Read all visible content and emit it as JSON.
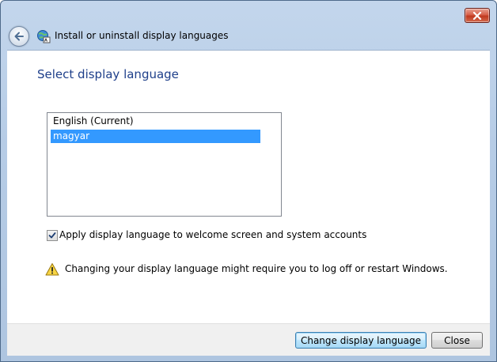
{
  "window": {
    "title": "Install or uninstall display languages"
  },
  "icons": {
    "close": "close-icon",
    "back": "back-arrow-icon",
    "app": "language-globe-icon",
    "warning": "warning-icon",
    "check": "check-icon"
  },
  "main": {
    "heading": "Select display language",
    "languages": [
      {
        "label": "English (Current)",
        "selected": false
      },
      {
        "label": "magyar",
        "selected": true
      }
    ],
    "apply_checkbox": {
      "label": "Apply display language to welcome screen and system accounts",
      "checked": true
    },
    "warning_text": "Changing your display language might require you to log off or restart Windows."
  },
  "footer": {
    "change_label": "Change display language",
    "close_label": "Close"
  },
  "colors": {
    "heading": "#1e3f8a",
    "selection": "#3399ff",
    "close_button": "#c0391f",
    "title_bar": "#b6cce6"
  }
}
